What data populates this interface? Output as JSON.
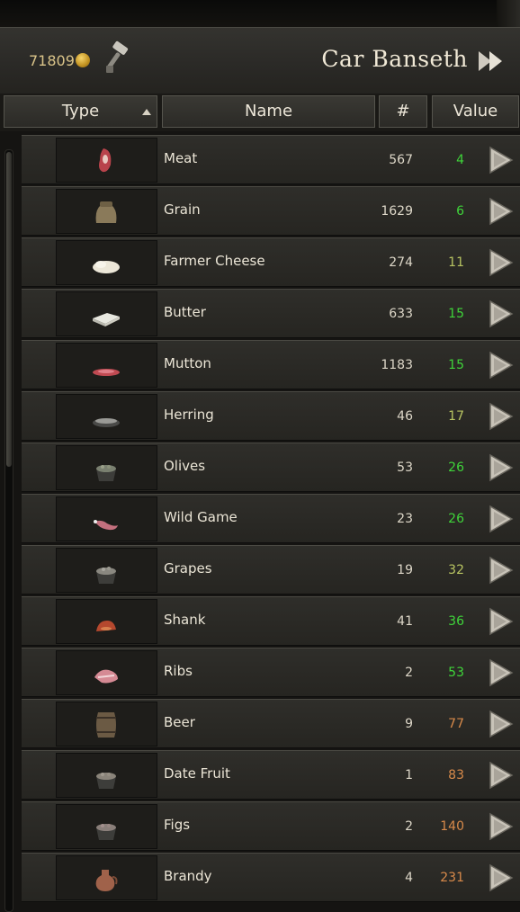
{
  "header": {
    "gold": "71809",
    "party_name": "Car Banseth"
  },
  "columns": {
    "type": "Type",
    "name": "Name",
    "count": "#",
    "value": "Value"
  },
  "colors": {
    "value_good": "#3fd43a",
    "value_mid": "#b8c462",
    "value_high": "#d88a4a"
  },
  "items": [
    {
      "name": "Meat",
      "count": "567",
      "value": "4",
      "icon": "meat-icon"
    },
    {
      "name": "Grain",
      "count": "1629",
      "value": "6",
      "icon": "grain-sack-icon"
    },
    {
      "name": "Farmer Cheese",
      "count": "274",
      "value": "11",
      "icon": "cheese-icon"
    },
    {
      "name": "Butter",
      "count": "633",
      "value": "15",
      "icon": "butter-icon"
    },
    {
      "name": "Mutton",
      "count": "1183",
      "value": "15",
      "icon": "mutton-icon"
    },
    {
      "name": "Herring",
      "count": "46",
      "value": "17",
      "icon": "fish-basket-icon"
    },
    {
      "name": "Olives",
      "count": "53",
      "value": "26",
      "icon": "olive-bucket-icon"
    },
    {
      "name": "Wild Game",
      "count": "23",
      "value": "26",
      "icon": "game-leg-icon"
    },
    {
      "name": "Grapes",
      "count": "19",
      "value": "32",
      "icon": "grape-bucket-icon"
    },
    {
      "name": "Shank",
      "count": "41",
      "value": "36",
      "icon": "shank-icon"
    },
    {
      "name": "Ribs",
      "count": "2",
      "value": "53",
      "icon": "ribs-icon"
    },
    {
      "name": "Beer",
      "count": "9",
      "value": "77",
      "icon": "barrel-icon"
    },
    {
      "name": "Date Fruit",
      "count": "1",
      "value": "83",
      "icon": "date-bucket-icon"
    },
    {
      "name": "Figs",
      "count": "2",
      "value": "140",
      "icon": "fig-bucket-icon"
    },
    {
      "name": "Brandy",
      "count": "4",
      "value": "231",
      "icon": "jug-icon"
    }
  ]
}
